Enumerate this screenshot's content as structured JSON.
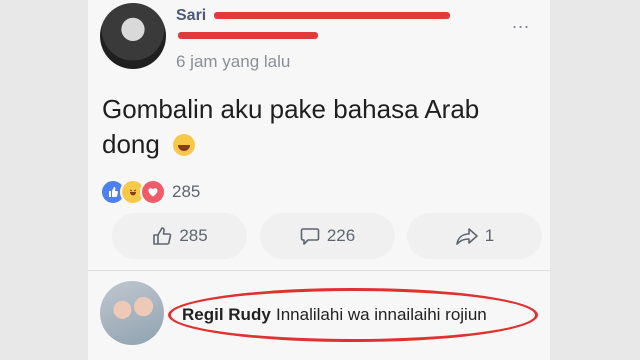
{
  "post": {
    "author": "Sari",
    "timestamp": "6 jam yang lalu",
    "text": "Gombalin aku pake bahasa Arab dong",
    "more_menu": "...",
    "reaction_count": "285",
    "reaction_icons": [
      "like-icon",
      "haha-icon",
      "love-icon"
    ]
  },
  "actions": {
    "likes": "285",
    "comments": "226",
    "shares": "1"
  },
  "comment": {
    "author": "Regil Rudy",
    "text": "Innalilahi wa innailaihi rojiun"
  },
  "colors": {
    "accent": "#4d7ff0",
    "highlight": "#e03131"
  }
}
